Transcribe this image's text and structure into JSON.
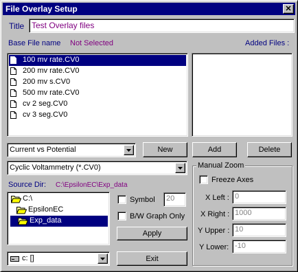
{
  "window": {
    "title": "File Overlay Setup",
    "close_label": "✕"
  },
  "title_field": {
    "label": "Title",
    "value": "Test Overlay files"
  },
  "base_file": {
    "label": "Base File name",
    "status": "Not Selected"
  },
  "added_files": {
    "label": "Added Files :"
  },
  "files": [
    {
      "name": "100 mv rate.CV0",
      "selected": true
    },
    {
      "name": "200 mv rate.CV0",
      "selected": false
    },
    {
      "name": "200 mv s.CV0",
      "selected": false
    },
    {
      "name": "500 mv rate.CV0",
      "selected": false
    },
    {
      "name": "cv 2 seg.CV0",
      "selected": false
    },
    {
      "name": "cv 3 seg.CV0",
      "selected": false
    }
  ],
  "plot_type": {
    "value": "Current vs Potential"
  },
  "buttons": {
    "new": "New",
    "add": "Add",
    "delete": "Delete",
    "apply": "Apply",
    "exit": "Exit"
  },
  "file_type": {
    "value": "Cyclic Voltammetry (*.CV0)"
  },
  "source_dir": {
    "label": "Source Dir:",
    "value": "C:\\EpsilonEC\\Exp_data"
  },
  "folders": [
    {
      "name": "C:\\",
      "selected": false,
      "open": true
    },
    {
      "name": "EpsilonEC",
      "selected": false,
      "open": true
    },
    {
      "name": "Exp_data",
      "selected": true,
      "open": true
    }
  ],
  "drive": {
    "value": "c: []"
  },
  "symbol": {
    "label": "Symbol",
    "checked": false,
    "value": "20"
  },
  "bw_graph": {
    "label": "B/W Graph Only",
    "checked": false
  },
  "manual_zoom": {
    "label": "Manual Zoom",
    "freeze_axes": {
      "label": "Freeze Axes",
      "checked": false
    },
    "x_left": {
      "label": "X Left :",
      "value": "0"
    },
    "x_right": {
      "label": "X Right :",
      "value": "1000"
    },
    "y_upper": {
      "label": "Y Upper :",
      "value": "10"
    },
    "y_lower": {
      "label": "Y Lower:",
      "value": "-10"
    }
  }
}
